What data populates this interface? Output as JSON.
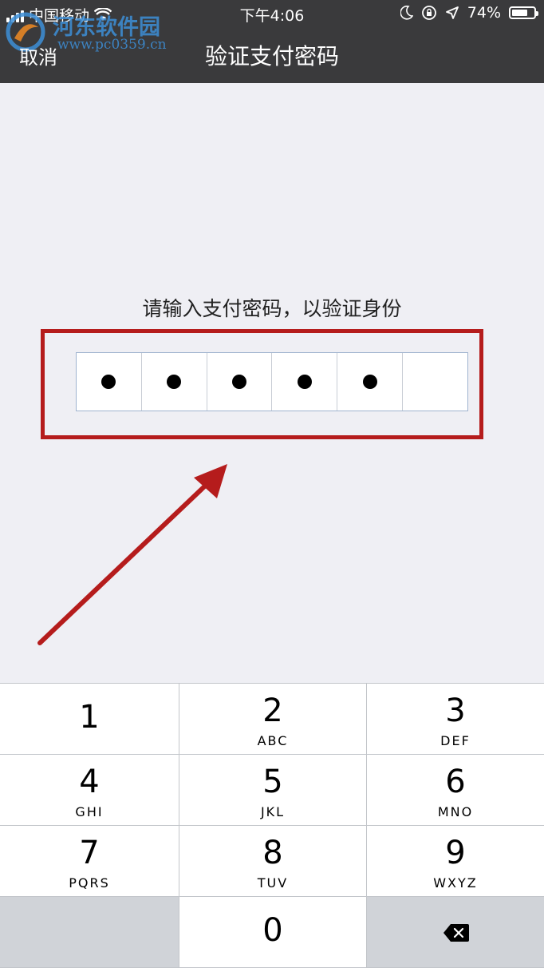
{
  "status_bar": {
    "carrier": "中国移动",
    "time": "下午4:06",
    "battery": "74%",
    "battery_level": 0.74
  },
  "watermark": {
    "name": "河东软件园",
    "url": "www.pc0359.cn"
  },
  "nav": {
    "cancel_label": "取消",
    "title": "验证支付密码"
  },
  "prompt": "请输入支付密码，以验证身份",
  "password": {
    "length": 6,
    "filled": 5,
    "dot": "●"
  },
  "keypad": {
    "keys": [
      {
        "number": "1",
        "letters": ""
      },
      {
        "number": "2",
        "letters": "ABC"
      },
      {
        "number": "3",
        "letters": "DEF"
      },
      {
        "number": "4",
        "letters": "GHI"
      },
      {
        "number": "5",
        "letters": "JKL"
      },
      {
        "number": "6",
        "letters": "MNO"
      },
      {
        "number": "7",
        "letters": "PQRS"
      },
      {
        "number": "8",
        "letters": "TUV"
      },
      {
        "number": "9",
        "letters": "WXYZ"
      },
      {
        "number": "0",
        "letters": ""
      }
    ],
    "backspace_icon": "backspace-icon"
  },
  "colors": {
    "highlight_box": "#b51c1c",
    "arrow": "#b51c1c",
    "nav_background": "#3a3a3c",
    "page_background": "#efeff4"
  }
}
